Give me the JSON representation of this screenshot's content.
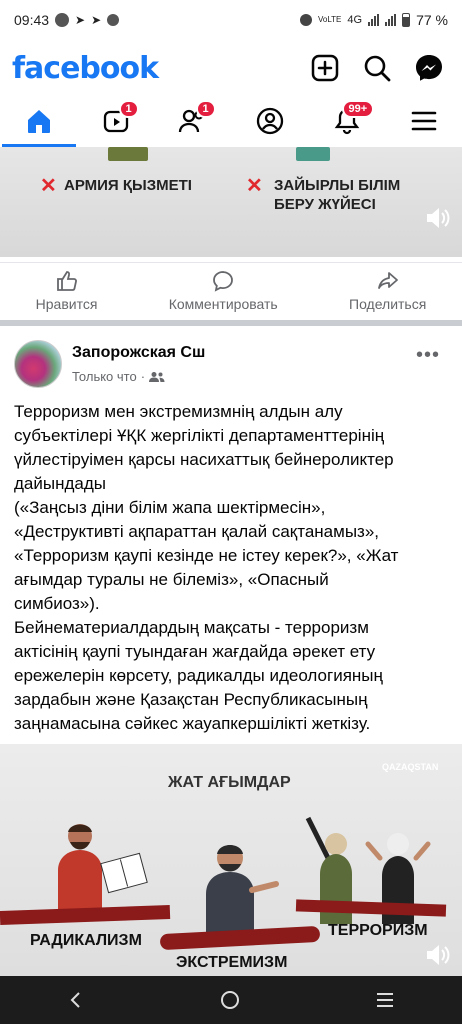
{
  "status": {
    "time": "09:43",
    "network": "4G",
    "battery": "77 %"
  },
  "header": {
    "logo": "facebook"
  },
  "tabs": [
    {
      "name": "home",
      "badge": ""
    },
    {
      "name": "video",
      "badge": "1"
    },
    {
      "name": "friends",
      "badge": "1"
    },
    {
      "name": "profile",
      "badge": ""
    },
    {
      "name": "notifications",
      "badge": "99+"
    },
    {
      "name": "menu",
      "badge": ""
    }
  ],
  "video1": {
    "label_left": "АРМИЯ ҚЫЗМЕТІ",
    "label_right_1": "ЗАЙЫРЛЫ БІЛІМ",
    "label_right_2": "БЕРУ ЖҮЙЕСІ"
  },
  "actions": {
    "like": "Нравится",
    "comment": "Комментировать",
    "share": "Поделиться"
  },
  "post": {
    "author": "Запорожская Сш",
    "time": "Только что",
    "text": [
      "Терроризм мен экстремизмнің алдын алу",
      "субъектілері ҰҚК жергілікті департаменттерінің",
      "үйлестіруімен қарсы насихаттық бейнероликтер",
      "дайындады",
      "(«Заңсыз діни білім жапа шектірмесін»,",
      "«Деструктивті ақпараттан қалай сақтанамыз»,",
      "«Терроризм қаупі кезінде не істеу керек?», «Жат",
      "ағымдар туралы не білеміз», «Опасный",
      "симбиоз»).",
      "Бейнематериалдардың мақсаты - терроризм",
      "актісінің қаупі туындаған жағдайда әрекет ету",
      "ережелерін көрсету, радикалды идеологияның",
      "зардабын және Қазақстан Республикасының",
      "заңнамасына сәйкес жауапкершілікті жеткізу."
    ]
  },
  "video2": {
    "title": "ЖАТ АҒЫМДАР",
    "brand": "QAZAQSTAN",
    "label_left": "РАДИКАЛИЗМ",
    "label_center": "ЭКСТРЕМИЗМ",
    "label_right": "ТЕРРОРИЗМ"
  },
  "colors": {
    "brand": "#1877f2",
    "badge": "#e41e3f",
    "ribbon": "#8b1a1a"
  }
}
